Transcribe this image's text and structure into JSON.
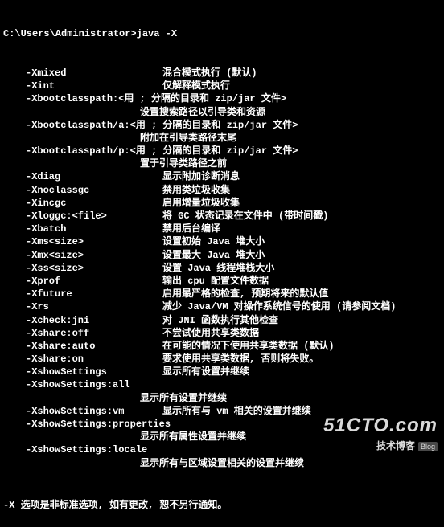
{
  "prompt": "C:\\Users\\Administrator>java -X",
  "options": [
    {
      "flag": "-Xmixed",
      "desc": "混合模式执行 (默认)"
    },
    {
      "flag": "-Xint",
      "desc": "仅解释模式执行"
    },
    {
      "flag": "-Xbootclasspath:<用 ; 分隔的目录和 zip/jar 文件>",
      "cont": "设置搜索路径以引导类和资源"
    },
    {
      "flag": "-Xbootclasspath/a:<用 ; 分隔的目录和 zip/jar 文件>",
      "cont": "附加在引导类路径末尾"
    },
    {
      "flag": "-Xbootclasspath/p:<用 ; 分隔的目录和 zip/jar 文件>",
      "cont": "置于引导类路径之前"
    },
    {
      "flag": "-Xdiag",
      "desc": "显示附加诊断消息"
    },
    {
      "flag": "-Xnoclassgc",
      "desc": "禁用类垃圾收集"
    },
    {
      "flag": "-Xincgc",
      "desc": "启用增量垃圾收集"
    },
    {
      "flag": "-Xloggc:<file>",
      "desc": "将 GC 状态记录在文件中 (带时间戳)"
    },
    {
      "flag": "-Xbatch",
      "desc": "禁用后台编译"
    },
    {
      "flag": "-Xms<size>",
      "desc": "设置初始 Java 堆大小"
    },
    {
      "flag": "-Xmx<size>",
      "desc": "设置最大 Java 堆大小"
    },
    {
      "flag": "-Xss<size>",
      "desc": "设置 Java 线程堆栈大小"
    },
    {
      "flag": "-Xprof",
      "desc": "输出 cpu 配置文件数据"
    },
    {
      "flag": "-Xfuture",
      "desc": "启用最严格的检查, 预期将来的默认值"
    },
    {
      "flag": "-Xrs",
      "desc": "减少 Java/VM 对操作系统信号的使用 (请参阅文档)"
    },
    {
      "flag": "-Xcheck:jni",
      "desc": "对 JNI 函数执行其他检查"
    },
    {
      "flag": "-Xshare:off",
      "desc": "不尝试使用共享类数据"
    },
    {
      "flag": "-Xshare:auto",
      "desc": "在可能的情况下使用共享类数据 (默认)"
    },
    {
      "flag": "-Xshare:on",
      "desc": "要求使用共享类数据, 否则将失败。"
    },
    {
      "flag": "-XshowSettings",
      "desc": "显示所有设置并继续"
    },
    {
      "flag": "-XshowSettings:all",
      "cont": "显示所有设置并继续"
    },
    {
      "flag": "-XshowSettings:vm",
      "desc": "显示所有与 vm 相关的设置并继续"
    },
    {
      "flag": "-XshowSettings:properties",
      "cont": "显示所有属性设置并继续"
    },
    {
      "flag": "-XshowSettings:locale",
      "cont": "显示所有与区域设置相关的设置并继续"
    }
  ],
  "footer": "-X 选项是非标准选项, 如有更改, 恕不另行通知。",
  "watermark": {
    "main": "51CTO.com",
    "sub": "技术博客",
    "tag": "Blog"
  }
}
